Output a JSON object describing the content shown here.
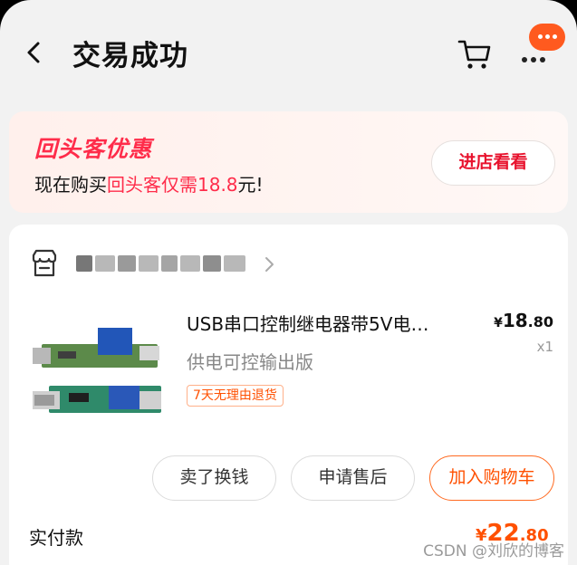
{
  "header": {
    "title": "交易成功",
    "icons": {
      "back": "back-arrow-icon",
      "cart": "cart-icon",
      "more": "more-icon",
      "message": "message-bubble-icon"
    }
  },
  "promo": {
    "title": "回头客优惠",
    "desc_prefix": "现在购买",
    "desc_highlight": "回头客仅需18.8",
    "desc_suffix": "元!",
    "button_label": "进店看看"
  },
  "order": {
    "store_name_visible": "",
    "product": {
      "title": "USB串口控制继电器带5V电…",
      "variant": "供电可控输出版",
      "badge": "7天无理由退货",
      "price_symbol": "¥",
      "price_int": "18",
      "price_dec": ".80",
      "quantity": "x1"
    },
    "actions": {
      "sell": "卖了换钱",
      "after_sale": "申请售后",
      "add_cart": "加入购物车"
    },
    "paid_label": "实付款",
    "paid_symbol": "¥",
    "paid_int": "22",
    "paid_dec": ".80"
  },
  "watermark": "CSDN @刘欣的博客",
  "colors": {
    "accent": "#ff5000",
    "promo_red": "#ff2c4a",
    "button_red": "#e8132e"
  }
}
